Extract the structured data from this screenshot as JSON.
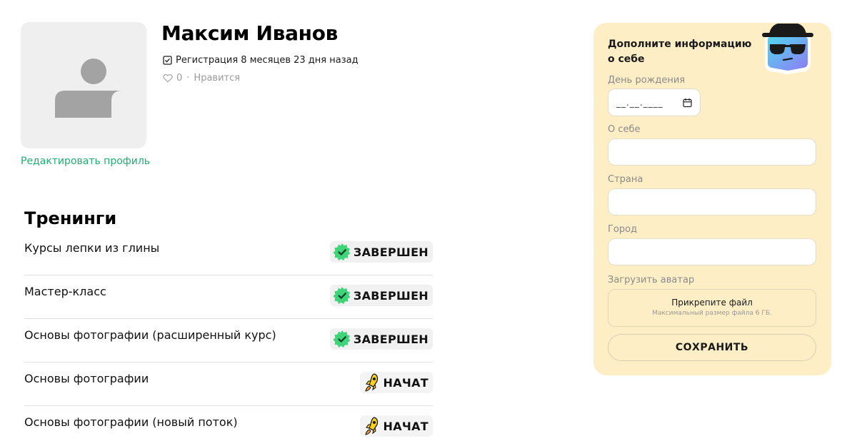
{
  "profile": {
    "name": "Максим Иванов",
    "registration": "Регистрация 8 месяцев 23 дня назад",
    "likes_count": "0",
    "likes_separator": "·",
    "likes_label": "Нравится",
    "edit_link": "Редактировать профиль"
  },
  "trainings": {
    "title": "Тренинги",
    "items": [
      {
        "name": "Курсы лепки из глины",
        "status": "ЗАВЕРШЕН",
        "status_type": "completed"
      },
      {
        "name": "Мастер-класс",
        "status": "ЗАВЕРШЕН",
        "status_type": "completed"
      },
      {
        "name": "Основы фотографии (расширенный курс)",
        "status": "ЗАВЕРШЕН",
        "status_type": "completed"
      },
      {
        "name": "Основы фотографии",
        "status": "НАЧАТ",
        "status_type": "started"
      },
      {
        "name": "Основы фотографии (новый поток)",
        "status": "НАЧАТ",
        "status_type": "started"
      }
    ]
  },
  "info_form": {
    "title": "Дополните информацию о себе",
    "birthday_label": "День рождения",
    "birthday_placeholder": "__.__.____",
    "about_label": "О себе",
    "about_value": "",
    "country_label": "Страна",
    "country_value": "",
    "city_label": "Город",
    "city_value": "",
    "avatar_label": "Загрузить аватар",
    "upload_title": "Прикрепите файл",
    "upload_hint": "Максимальный размер файла 6 ГБ.",
    "save_label": "СОХРАНИТЬ"
  },
  "icons": {
    "avatar": "user-silhouette-icon",
    "registration": "checkbox-icon",
    "likes": "heart-icon",
    "completed": "checkmark-badge-icon",
    "started": "rocket-icon",
    "calendar": "calendar-icon",
    "mascot": "spy-mascot-icon"
  },
  "colors": {
    "accent_green": "#1fb070",
    "card_background": "#fdeec6",
    "completed_badge": "#3fd47a",
    "started_badge": "#ffd21a"
  }
}
